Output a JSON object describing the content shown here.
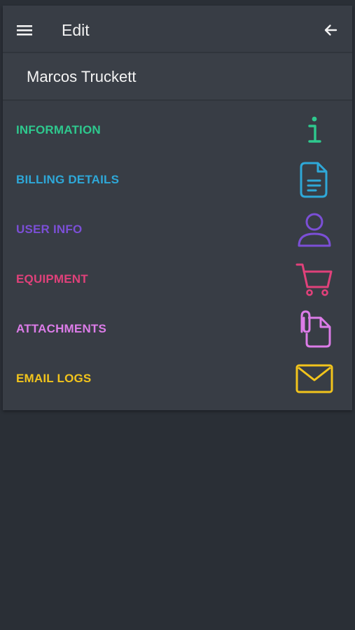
{
  "app_bar": {
    "title": "Edit",
    "menu_icon": "hamburger-menu-icon",
    "back_icon": "arrow-left-icon"
  },
  "user": {
    "name": "Marcos Truckett"
  },
  "nav_items": [
    {
      "label": "INFORMATION",
      "icon": "info-icon",
      "color": "#2ec98e"
    },
    {
      "label": "BILLING DETAILS",
      "icon": "document-icon",
      "color": "#2ea8d8"
    },
    {
      "label": "USER INFO",
      "icon": "user-icon",
      "color": "#7b4fd6"
    },
    {
      "label": "EQUIPMENT",
      "icon": "cart-icon",
      "color": "#e0417a"
    },
    {
      "label": "ATTACHMENTS",
      "icon": "attachment-icon",
      "color": "#dc7ce8"
    },
    {
      "label": "EMAIL LOGS",
      "icon": "envelope-icon",
      "color": "#f2c41c"
    }
  ],
  "colors": {
    "background": "#2a2f36",
    "panel": "#383d45",
    "text": "#f2f2f2"
  }
}
